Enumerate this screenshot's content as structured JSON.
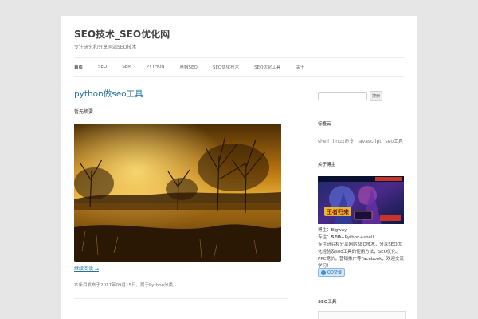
{
  "site": {
    "title": "SEO技术_SEO优化网",
    "description": "专注研究和分享网站SEO技术"
  },
  "nav": {
    "items": [
      {
        "label": "首页",
        "active": true
      },
      {
        "label": "SEO",
        "active": false
      },
      {
        "label": "SEM",
        "active": false
      },
      {
        "label": "Python",
        "active": false
      },
      {
        "label": "黑帽SEO",
        "active": false
      },
      {
        "label": "SEO优化技术",
        "active": false
      },
      {
        "label": "SEO优化工具",
        "active": false
      },
      {
        "label": "关于",
        "active": false
      }
    ]
  },
  "post": {
    "title": "python做seo工具",
    "intro": "暂无摘要",
    "read_more": "继续阅读 →",
    "meta": "本条目发布于2017年09月15日，属于Python分类。"
  },
  "sidebar": {
    "search_placeholder": "",
    "search_button": "搜索",
    "tags_title": "标签云",
    "tags": [
      "shell",
      "linux命令",
      "javascript",
      "seo工具"
    ],
    "about_title": "关于博主",
    "banner_text": "王者归来",
    "about_line1": "博主：Bigway",
    "about_line2_prefix": "专注：",
    "about_line2_bold": "SEO",
    "about_line2_suffix": "+Python+shell",
    "about_line3": "专注研究和分享网站SEO技术，分享SEO优化经验及seo工具的使用方法，SEO优化、PPC竞价，营销推广等Facebook，欢迎交流学习！",
    "qq_label": "QQ交谈",
    "seo_tools_title": "SEO工具"
  },
  "colors": {
    "link": "#21759b",
    "background": "#e6e6e6"
  }
}
